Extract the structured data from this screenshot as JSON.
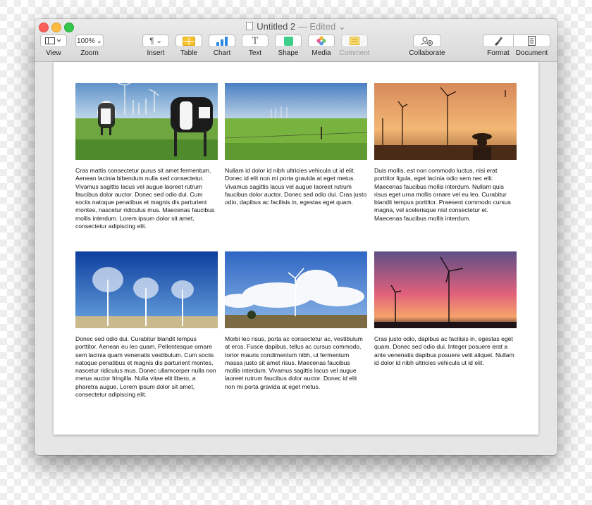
{
  "window": {
    "title": "Untitled 2",
    "title_status": "— Edited"
  },
  "toolbar": {
    "view": {
      "label": "View",
      "icon": "sidebar-icon"
    },
    "zoom": {
      "label": "Zoom",
      "value": "100%"
    },
    "insert": {
      "label": "Insert",
      "icon": "pilcrow-icon"
    },
    "table": {
      "label": "Table",
      "icon": "table-icon"
    },
    "chart": {
      "label": "Chart",
      "icon": "bar-chart-icon"
    },
    "text": {
      "label": "Text",
      "icon": "text-t-icon"
    },
    "shape": {
      "label": "Shape",
      "icon": "square-shape-icon"
    },
    "media": {
      "label": "Media",
      "icon": "photos-flower-icon"
    },
    "comment": {
      "label": "Comment",
      "icon": "comment-note-icon"
    },
    "collaborate": {
      "label": "Collaborate",
      "icon": "person-add-icon"
    },
    "format": {
      "label": "Format",
      "icon": "paintbrush-icon"
    },
    "document": {
      "label": "Document",
      "icon": "document-icon"
    }
  },
  "cells": [
    {
      "image": "cows-grazing-near-wind-turbines-photo",
      "text": "Cras mattis consectetur purus sit amet fermentum. Aenean lacinia bibendum nulla sed consectetur. Vivamus sagittis lacus vel augue laoreet rutrum faucibus dolor auctor. Donec sed odio dui. Cum sociis natoque penatibus et magnis dis parturient montes, nascetur ridiculus mus. Maecenas faucibus mollis interdum. Lorem ipsum dolor sit amet, consectetur adipiscing elit."
    },
    {
      "image": "green-field-wind-farm-photo",
      "text": "Nullam id dolor id nibh ultricies vehicula ut id elit. Donec id elit non mi porta gravida at eget metus. Vivamus sagittis lacus vel augue laoreet rutrum faucibus dolor auctor. Donec sed odio dui. Cras justo odio, dapibus ac facilisis in, egestas eget quam."
    },
    {
      "image": "sunset-turbines-farmer-photo",
      "text": "Duis mollis, est non commodo luctus, nisi erat porttitor ligula, eget lacinia odio sem nec elit. Maecenas faucibus mollis interdum. Nullam quis risus eget urna mollis ornare vel eu leo. Curabitur blandit tempus porttitor. Praesent commodo cursus magna, vel scelerisque nisl consectetur et. Maecenas faucibus mollis interdum."
    },
    {
      "image": "spinning-turbines-blue-sky-photo",
      "text": "Donec sed odio dui. Curabitur blandit tempus porttitor. Aenean eu leo quam. Pellentesque ornare sem lacinia quam venenatis vestibulum. Cum sociis natoque penatibus et magnis dis parturient montes, nascetur ridiculus mus. Donec ullamcorper nulla non metus auctor fringilla. Nulla vitae elit libero, a pharetra augue. Lorem ipsum dolor sit amet, consectetur adipiscing elit."
    },
    {
      "image": "turbine-clouds-photo",
      "text": "Morbi leo risus, porta ac consectetur ac, vestibulum at eros. Fusce dapibus, tellus ac cursus commodo, tortor mauris condimentum nibh, ut fermentum massa justo sit amet risus. Maecenas faucibus mollis interdum. Vivamus sagittis lacus vel augue laoreet rutrum faucibus dolor auctor. Donec id elit non mi porta gravida at eget metus."
    },
    {
      "image": "pink-sunset-turbines-photo",
      "text": "Cras justo odio, dapibus ac facilisis in, egestas eget quam. Donec sed odio dui. Integer posuere erat a ante venenatis dapibus posuere velit aliquet. Nullam id dolor id nibh ultricies vehicula ut id elit."
    }
  ]
}
